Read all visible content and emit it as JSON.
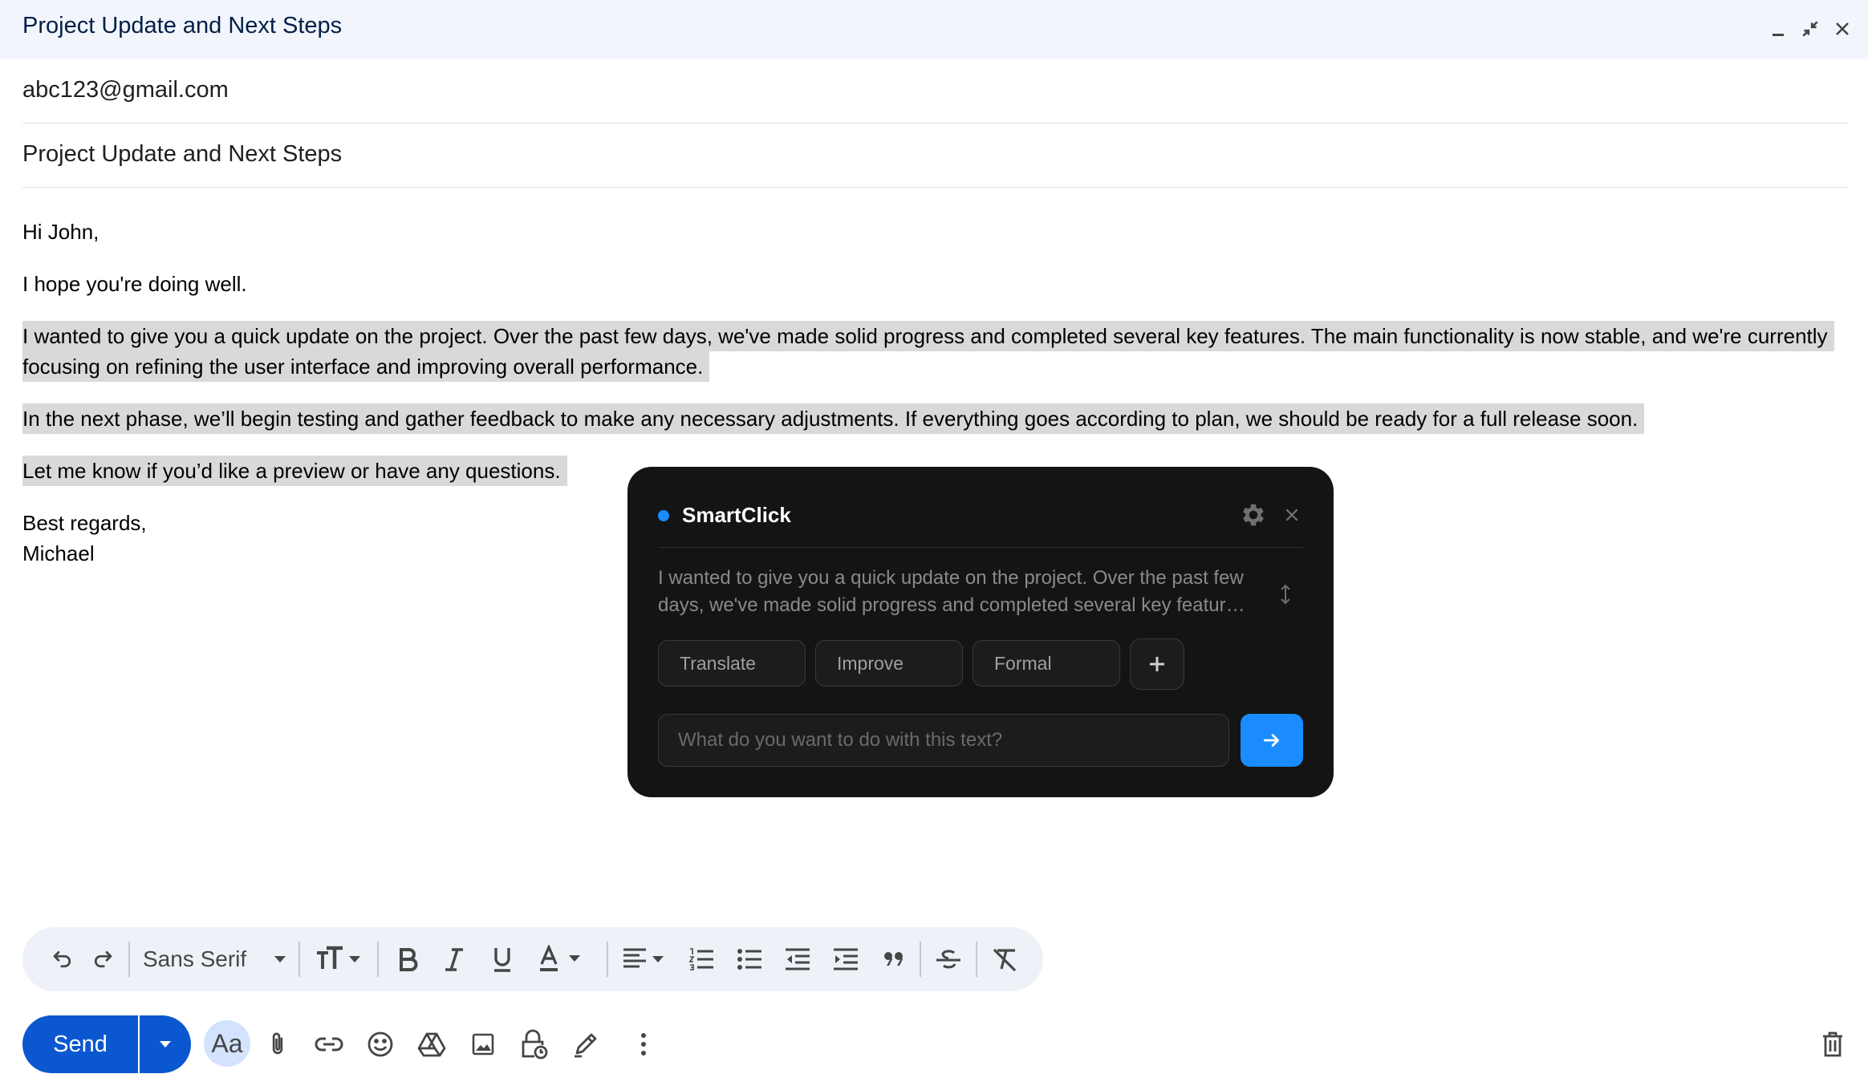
{
  "window": {
    "title": "Project Update and Next Steps"
  },
  "compose": {
    "to": "abc123@gmail.com",
    "subject": "Project Update and Next Steps",
    "body": {
      "greeting": "Hi John,",
      "line1": "I hope you're doing well.",
      "para1": "I wanted to give you a quick update on the project. Over the past few days, we've made solid progress and completed several key features. The main functionality is now stable, and we're currently focusing on refining the user interface and improving overall performance.",
      "para2": "In the next phase, we’ll begin testing and gather feedback to make any necessary adjustments. If everything goes according to plan, we should be ready for a full release soon.",
      "para3": "Let me know if you’d like a preview or have any questions.",
      "closing": "Best regards,",
      "signature": "Michael"
    }
  },
  "smartclick": {
    "title": "SmartClick",
    "preview": "I wanted to give you a quick update on the project. Over the past few days, we've made solid progress and completed several key features. The main functionality is now stable, and we're currently focusing on refining the user interface and improving overall performance.",
    "actions": [
      "Translate",
      "Improve",
      "Formal"
    ],
    "input_placeholder": "What do you want to do with this text?",
    "accent_color": "#1a8cff"
  },
  "toolbar": {
    "font": "Sans Serif"
  },
  "bottom": {
    "send_label": "Send",
    "text_format_label": "Aa"
  }
}
